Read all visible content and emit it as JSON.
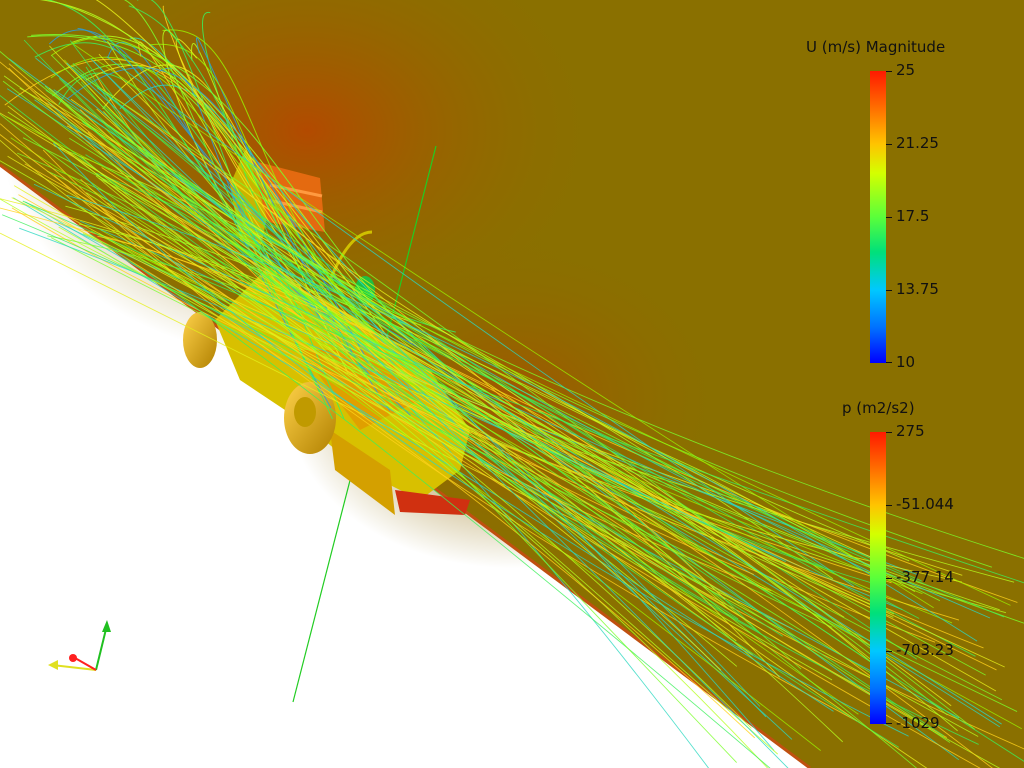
{
  "viewport": {
    "background_color": "#8a7000",
    "ground_color": "#ffffff"
  },
  "legend_velocity": {
    "title": "U (m/s) Magnitude",
    "ticks": [
      "25",
      "21.25",
      "17.5",
      "13.75",
      "10"
    ]
  },
  "legend_pressure": {
    "title": "p (m2/s2)",
    "ticks": [
      "275",
      "-51.044",
      "-377.14",
      "-703.23",
      "-1029"
    ]
  },
  "axes_widget": {
    "x_color": "#ff2020",
    "y_color": "#20c020",
    "z_color": "#e0e020"
  }
}
